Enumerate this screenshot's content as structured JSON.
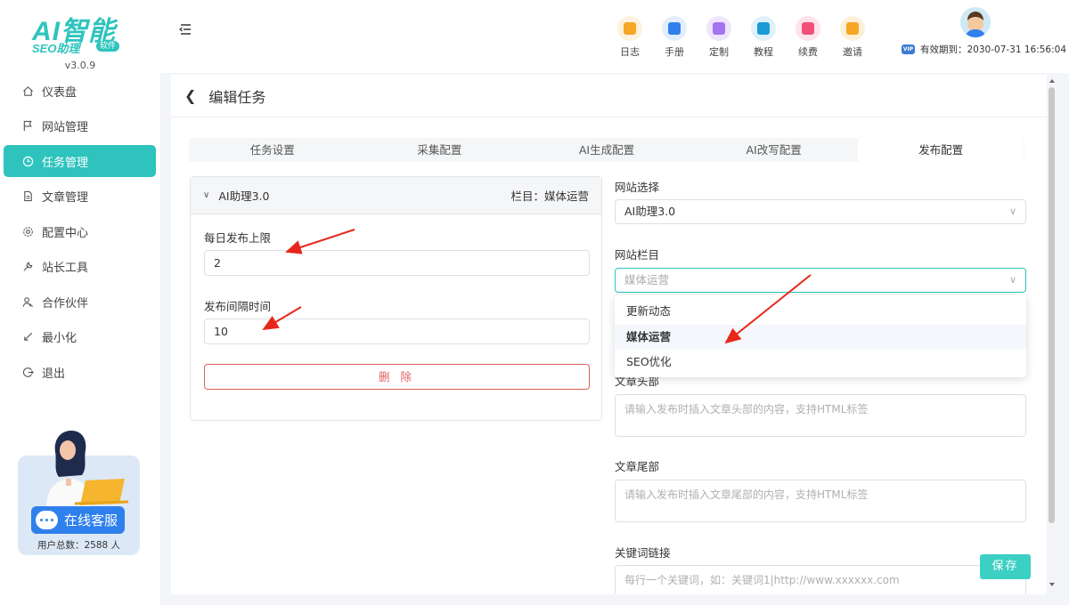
{
  "brand": {
    "name": "AI智能",
    "sub": "SEO助理",
    "tag": "软件",
    "version": "v3.0.9"
  },
  "sidebar": {
    "items": [
      {
        "label": "仪表盘",
        "icon": "home-icon"
      },
      {
        "label": "网站管理",
        "icon": "flag-icon"
      },
      {
        "label": "任务管理",
        "icon": "clock-icon",
        "active": true
      },
      {
        "label": "文章管理",
        "icon": "document-icon"
      },
      {
        "label": "配置中心",
        "icon": "gear-icon"
      },
      {
        "label": "站长工具",
        "icon": "wrench-icon"
      },
      {
        "label": "合作伙伴",
        "icon": "users-icon"
      },
      {
        "label": "最小化",
        "icon": "minimize-icon"
      },
      {
        "label": "退出",
        "icon": "logout-icon"
      }
    ],
    "support": {
      "button_label": "在线客服",
      "user_count": "用户总数：2588 人"
    }
  },
  "header": {
    "tools": [
      {
        "label": "日志",
        "icon": "log-icon",
        "color": "#f5a623"
      },
      {
        "label": "手册",
        "icon": "manual-icon",
        "color": "#2f80ed"
      },
      {
        "label": "定制",
        "icon": "custom-icon",
        "color": "#a574f0"
      },
      {
        "label": "教程",
        "icon": "tutorial-icon",
        "color": "#1a9ad6"
      },
      {
        "label": "续费",
        "icon": "renew-icon",
        "color": "#f0507a"
      },
      {
        "label": "邀请",
        "icon": "invite-icon",
        "color": "#f5a623"
      }
    ],
    "vip_badge": "VIP",
    "expire": "有效期到：2030-07-31 16:56:04"
  },
  "page": {
    "title": "编辑任务"
  },
  "tabs": [
    {
      "label": "任务设置"
    },
    {
      "label": "采集配置"
    },
    {
      "label": "AI生成配置"
    },
    {
      "label": "AI改写配置"
    },
    {
      "label": "发布配置",
      "active": true
    }
  ],
  "site_card": {
    "name": "AI助理3.0",
    "column": "栏目：媒体运营",
    "daily_limit_label": "每日发布上限",
    "daily_limit_value": "2",
    "interval_label": "发布间隔时间",
    "interval_value": "10",
    "delete_label": "删 除"
  },
  "right": {
    "site_select_label": "网站选择",
    "site_select_value": "AI助理3.0",
    "column_label": "网站栏目",
    "column_placeholder": "媒体运营",
    "column_options": [
      "更新动态",
      "媒体运营",
      "SEO优化"
    ],
    "selected_option": "媒体运营",
    "header_label": "文章头部",
    "header_placeholder": "请输入发布时插入文章头部的内容，支持HTML标签",
    "footer_label": "文章尾部",
    "footer_placeholder": "请输入发布时插入文章尾部的内容，支持HTML标签",
    "keyword_label": "关键词链接",
    "keyword_placeholder": "每行一个关键词，如：关键词1|http://www.xxxxxx.com"
  },
  "save_label": "保存",
  "colors": {
    "accent": "#2ec4bd",
    "danger": "#e06060",
    "annotation": "#e8271b"
  }
}
